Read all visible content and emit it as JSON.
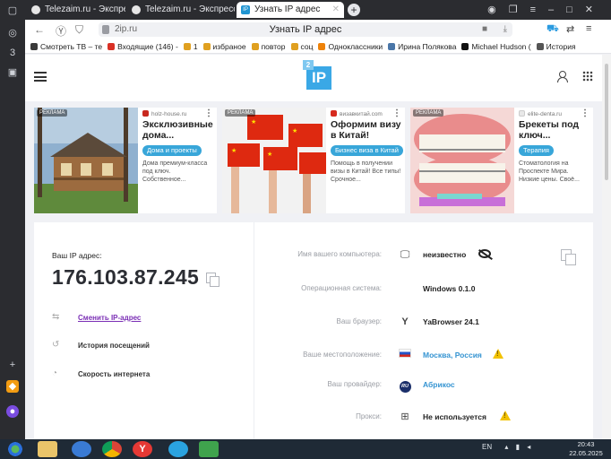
{
  "browser": {
    "tabs": [
      {
        "label": "Telezaim.ru - Экспресс он"
      },
      {
        "label": "Telezaim.ru - Экспресс он"
      },
      {
        "label": "Узнать IP адрес",
        "favicon": "IP"
      }
    ],
    "url": "2ip.ru",
    "page_title": "Узнать IP адрес",
    "bookmarks": [
      {
        "label": "Смотреть ТВ – те",
        "color": "#3a3a3a"
      },
      {
        "label": "Входящие (146) -",
        "color": "#d93025"
      },
      {
        "label": "1",
        "color": "#e0a020"
      },
      {
        "label": "избраное",
        "color": "#e0a020"
      },
      {
        "label": "повтор",
        "color": "#e0a020"
      },
      {
        "label": "соц",
        "color": "#e0a020"
      },
      {
        "label": "Одноклассники",
        "color": "#ee8208"
      },
      {
        "label": "Ирина Полякова",
        "color": "#4a76a8"
      },
      {
        "label": "Michael Hudson (",
        "color": "#111111"
      },
      {
        "label": "История",
        "color": "#555555"
      }
    ]
  },
  "site": {
    "logo_badge": "2",
    "logo_text": "IP"
  },
  "ads": [
    {
      "reklama": "РЕКЛАМА",
      "domain": "holz-house.ru",
      "title": "Эксклюзивные дома...",
      "button": "Дома и проекты",
      "desc": "Дома премиум-класса под ключ. Собственное...",
      "dom_color": "#c8281e"
    },
    {
      "reklama": "РЕКЛАМА",
      "domain": "визавкитай.com",
      "title": "Оформим визу в Китай!",
      "button": "Бизнес виза в Китай",
      "desc": "Помощь в получении визы в Китай! Все типы! Срочное...",
      "dom_color": "#d62a1e"
    },
    {
      "reklama": "РЕКЛАМА",
      "domain": "elite-denta.ru",
      "title": "Брекеты под ключ...",
      "button": "Терапия",
      "desc": "Стоматология на Проспекте Мира. Низкие цены. Своё...",
      "dom_color": "#e8e8e8"
    }
  ],
  "ipcard": {
    "ip_label": "Ваш IP адрес:",
    "ip_value": "176.103.87.245",
    "actions": [
      {
        "label": "Сменить IP-адрес",
        "icon": "change-ip-icon",
        "link": true
      },
      {
        "label": "История посещений",
        "icon": "history-icon",
        "link": false
      },
      {
        "label": "Скорость интернета",
        "icon": "speed-icon",
        "link": false
      }
    ],
    "info": [
      {
        "key": "Имя вашего компьютера:",
        "value": "неизвестно",
        "icon": "monitor-icon"
      },
      {
        "key": "Операционная система:",
        "value": "Windows 0.1.0",
        "icon": "windows-icon"
      },
      {
        "key": "Ваш браузер:",
        "value": "YaBrowser 24.1",
        "icon": "yandex-browser-icon"
      },
      {
        "key": "Ваше местоположение:",
        "value": "Москва, Россия",
        "icon": "russia-flag-icon"
      },
      {
        "key": "Ваш провайдер:",
        "value": "Абрикос",
        "icon": "provider-logo-icon",
        "badge": "RU"
      },
      {
        "key": "Прокси:",
        "value": "Не используется",
        "icon": "network-icon"
      }
    ]
  },
  "taskbar": {
    "lang": "EN",
    "time": "20:43",
    "date": "22.05.2025"
  },
  "colors": {
    "accent": "#3aa8e6",
    "link": "#7b2fb5",
    "warning": "#f2c200"
  }
}
